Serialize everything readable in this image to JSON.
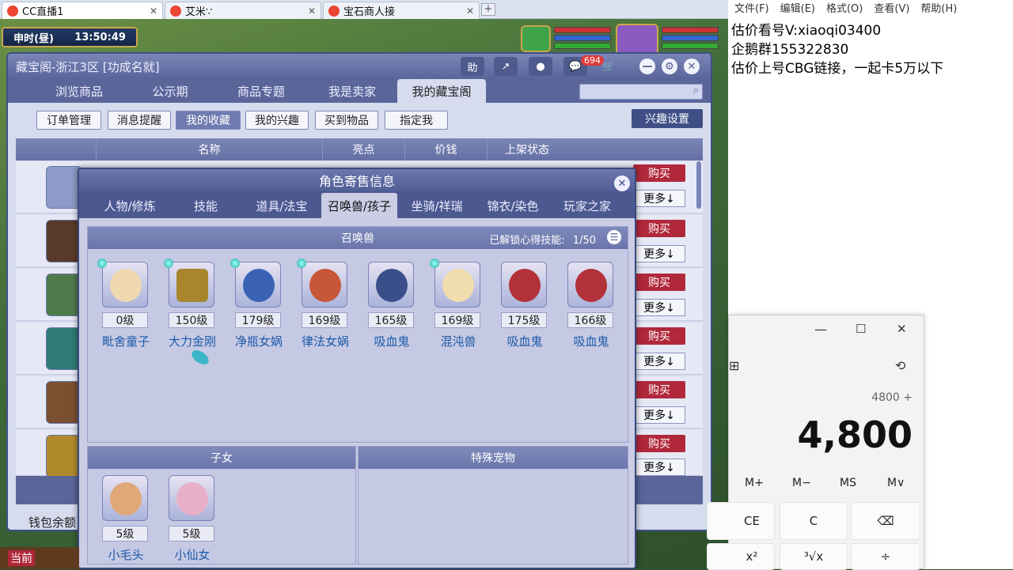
{
  "browser": {
    "tabs": [
      {
        "label": "CC直播1",
        "active": true
      },
      {
        "label": "艾米∵",
        "active": false
      },
      {
        "label": "宝石商人接",
        "active": false
      }
    ],
    "new_tab": "+"
  },
  "game": {
    "time_label": "申时(昼)",
    "clock": "13:50:49",
    "footer_left": "当前"
  },
  "window": {
    "title": "藏宝阁-浙江3区 [功成名就]",
    "header_buttons": {
      "help": "助",
      "share": "↗",
      "record": "●",
      "messages": "💬",
      "cart": "🛒"
    },
    "message_count": "694",
    "nav_tabs": [
      "浏览商品",
      "公示期",
      "商品专题",
      "我是卖家",
      "我的藏宝阁"
    ],
    "sub_buttons": [
      "订单管理",
      "消息提醒",
      "我的收藏",
      "我的兴趣",
      "买到物品",
      "指定我"
    ],
    "interest_settings": "兴趣设置",
    "table_headers": [
      "名称",
      "亮点",
      "价钱",
      "上架状态"
    ],
    "rows": [
      {
        "buy": "购买",
        "more": "更多↓"
      },
      {
        "buy": "购买",
        "more": "更多↓"
      },
      {
        "buy": "购买",
        "more": "更多↓"
      },
      {
        "buy": "购买",
        "more": "更多↓"
      },
      {
        "buy": "购买",
        "more": "更多↓"
      },
      {
        "buy": "购买",
        "more": "更多↓"
      }
    ],
    "wallet_label": "钱包余额"
  },
  "dialog": {
    "title": "角色寄售信息",
    "close": "✕",
    "tabs": [
      "人物/修炼",
      "技能",
      "道具/法宝",
      "召唤兽/孩子",
      "坐骑/祥瑞",
      "锦衣/染色",
      "玩家之家"
    ],
    "active_tab": 3,
    "pets_header": "召唤兽",
    "skill_unlock_label": "已解锁心得技能:",
    "skill_unlock_value": "1/50",
    "pets": [
      {
        "level": "0级",
        "name": "毗舍童子"
      },
      {
        "level": "150级",
        "name": "大力金刚"
      },
      {
        "level": "179级",
        "name": "净瓶女娲"
      },
      {
        "level": "169级",
        "name": "律法女娲"
      },
      {
        "level": "165级",
        "name": "吸血鬼"
      },
      {
        "level": "169级",
        "name": "混沌兽"
      },
      {
        "level": "175级",
        "name": "吸血鬼"
      },
      {
        "level": "166级",
        "name": "吸血鬼"
      }
    ],
    "children_header": "子女",
    "children": [
      {
        "level": "5级",
        "name": "小毛头"
      },
      {
        "level": "5级",
        "name": "小仙女"
      }
    ],
    "special_pets_header": "特殊宠物"
  },
  "notepad": {
    "menu": [
      "文件(F)",
      "编辑(E)",
      "格式(O)",
      "查看(V)",
      "帮助(H)"
    ],
    "lines": [
      "估价看号V:xiaoqi03400",
      "企鹅群155322830",
      "估价上号CBG链接，一起卡5万以下"
    ]
  },
  "calculator": {
    "expression": "4800 +",
    "display": "4,800",
    "memory": [
      "M+",
      "M−",
      "MS",
      "M∨"
    ],
    "keys": [
      "CE",
      "C",
      "⌫"
    ],
    "bottom_keys": [
      "x²",
      "³√x",
      "÷"
    ]
  },
  "colors": {
    "accent": "#3f4f86",
    "buy": "#b0283a",
    "pet_name": "#1c5aa8"
  }
}
